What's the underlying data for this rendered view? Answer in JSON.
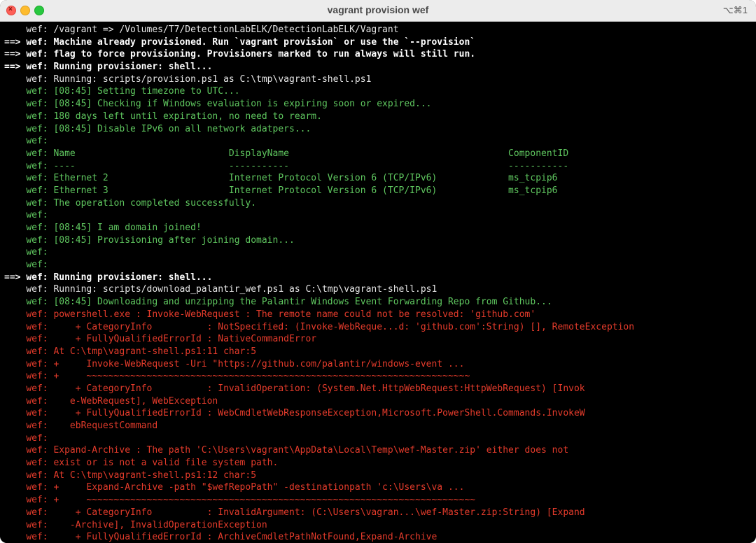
{
  "window": {
    "title": "vagrant provision wef",
    "shortcut": "⌥⌘1"
  },
  "terminal": {
    "lines": [
      {
        "p": "    ",
        "t": "wef: /vagrant => /Volumes/T7/DetectionLabELK/DetectionLabELK/Vagrant",
        "c": "white"
      },
      {
        "p": "==> ",
        "t": "wef: Machine already provisioned. Run `vagrant provision` or use the `--provision`",
        "c": "white-bold"
      },
      {
        "p": "==> ",
        "t": "wef: flag to force provisioning. Provisioners marked to run always will still run.",
        "c": "white-bold"
      },
      {
        "p": "==> ",
        "t": "wef: Running provisioner: shell...",
        "c": "white-bold"
      },
      {
        "p": "    ",
        "t": "wef: Running: scripts/provision.ps1 as C:\\tmp\\vagrant-shell.ps1",
        "c": "white"
      },
      {
        "p": "    ",
        "t": "wef: [08:45] Setting timezone to UTC...",
        "c": "green"
      },
      {
        "p": "    ",
        "t": "wef: [08:45] Checking if Windows evaluation is expiring soon or expired...",
        "c": "green"
      },
      {
        "p": "    ",
        "t": "wef: 180 days left until expiration, no need to rearm.",
        "c": "green"
      },
      {
        "p": "    ",
        "t": "wef: [08:45] Disable IPv6 on all network adatpers...",
        "c": "green"
      },
      {
        "p": "    ",
        "t": "wef:",
        "c": "green"
      },
      {
        "p": "    ",
        "t": "wef: Name                            DisplayName                                        ComponentID",
        "c": "green"
      },
      {
        "p": "    ",
        "t": "wef: ----                            -----------                                        -----------",
        "c": "green"
      },
      {
        "p": "    ",
        "t": "wef: Ethernet 2                      Internet Protocol Version 6 (TCP/IPv6)             ms_tcpip6",
        "c": "green"
      },
      {
        "p": "    ",
        "t": "wef: Ethernet 3                      Internet Protocol Version 6 (TCP/IPv6)             ms_tcpip6",
        "c": "green"
      },
      {
        "p": "    ",
        "t": "wef: The operation completed successfully.",
        "c": "green"
      },
      {
        "p": "    ",
        "t": "wef:",
        "c": "green"
      },
      {
        "p": "    ",
        "t": "wef: [08:45] I am domain joined!",
        "c": "green"
      },
      {
        "p": "    ",
        "t": "wef: [08:45] Provisioning after joining domain...",
        "c": "green"
      },
      {
        "p": "    ",
        "t": "wef:",
        "c": "green"
      },
      {
        "p": "    ",
        "t": "wef:",
        "c": "green"
      },
      {
        "p": "==> ",
        "t": "wef: Running provisioner: shell...",
        "c": "white-bold"
      },
      {
        "p": "    ",
        "t": "wef: Running: scripts/download_palantir_wef.ps1 as C:\\tmp\\vagrant-shell.ps1",
        "c": "white"
      },
      {
        "p": "    ",
        "t": "wef: [08:45] Downloading and unzipping the Palantir Windows Event Forwarding Repo from Github...",
        "c": "green"
      },
      {
        "p": "    ",
        "t": "wef: powershell.exe : Invoke-WebRequest : The remote name could not be resolved: 'github.com'",
        "c": "red"
      },
      {
        "p": "    ",
        "t": "wef:     + CategoryInfo          : NotSpecified: (Invoke-WebReque...d: 'github.com':String) [], RemoteException",
        "c": "red"
      },
      {
        "p": "    ",
        "t": "wef:     + FullyQualifiedErrorId : NativeCommandError",
        "c": "red"
      },
      {
        "p": "    ",
        "t": "wef: At C:\\tmp\\vagrant-shell.ps1:11 char:5",
        "c": "red"
      },
      {
        "p": "    ",
        "t": "wef: +     Invoke-WebRequest -Uri \"https://github.com/palantir/windows-event ...",
        "c": "red"
      },
      {
        "p": "    ",
        "t": "wef: +     ~~~~~~~~~~~~~~~~~~~~~~~~~~~~~~~~~~~~~~~~~~~~~~~~~~~~~~~~~~~~~~~~~~~~~~",
        "c": "red"
      },
      {
        "p": "    ",
        "t": "wef:     + CategoryInfo          : InvalidOperation: (System.Net.HttpWebRequest:HttpWebRequest) [Invok",
        "c": "red"
      },
      {
        "p": "    ",
        "t": "wef:    e-WebRequest], WebException",
        "c": "red"
      },
      {
        "p": "    ",
        "t": "wef:     + FullyQualifiedErrorId : WebCmdletWebResponseException,Microsoft.PowerShell.Commands.InvokeW",
        "c": "red"
      },
      {
        "p": "    ",
        "t": "wef:    ebRequestCommand",
        "c": "red"
      },
      {
        "p": "    ",
        "t": "wef:",
        "c": "red"
      },
      {
        "p": "    ",
        "t": "wef: Expand-Archive : The path 'C:\\Users\\vagrant\\AppData\\Local\\Temp\\wef-Master.zip' either does not",
        "c": "red"
      },
      {
        "p": "    ",
        "t": "wef: exist or is not a valid file system path.",
        "c": "red"
      },
      {
        "p": "    ",
        "t": "wef: At C:\\tmp\\vagrant-shell.ps1:12 char:5",
        "c": "red"
      },
      {
        "p": "    ",
        "t": "wef: +     Expand-Archive -path \"$wefRepoPath\" -destinationpath 'c:\\Users\\va ...",
        "c": "red"
      },
      {
        "p": "    ",
        "t": "wef: +     ~~~~~~~~~~~~~~~~~~~~~~~~~~~~~~~~~~~~~~~~~~~~~~~~~~~~~~~~~~~~~~~~~~~~~~~",
        "c": "red"
      },
      {
        "p": "    ",
        "t": "wef:     + CategoryInfo          : InvalidArgument: (C:\\Users\\vagran...\\wef-Master.zip:String) [Expand",
        "c": "red"
      },
      {
        "p": "    ",
        "t": "wef:    -Archive], InvalidOperationException",
        "c": "red"
      },
      {
        "p": "    ",
        "t": "wef:     + FullyQualifiedErrorId : ArchiveCmdletPathNotFound,Expand-Archive",
        "c": "red"
      }
    ]
  }
}
